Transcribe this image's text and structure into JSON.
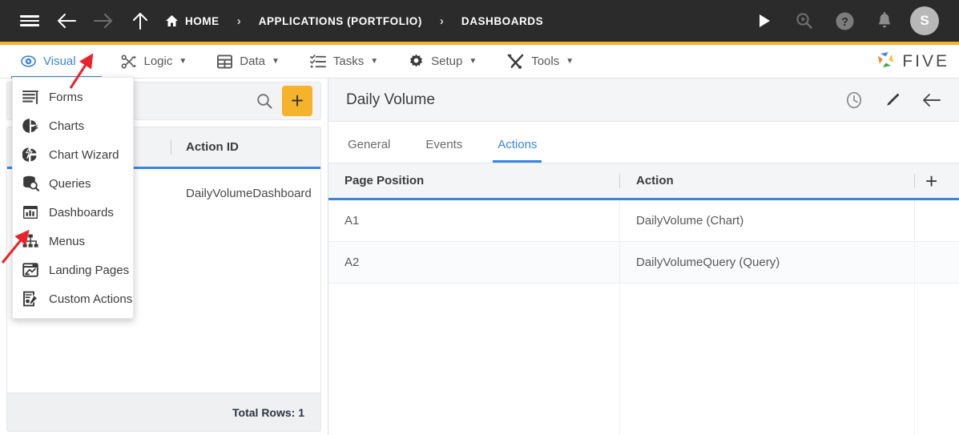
{
  "topbar": {
    "menu_icon": "hamburger-icon",
    "back_icon": "arrow-left-icon",
    "forward_icon": "arrow-right-icon",
    "up_icon": "arrow-up-icon",
    "breadcrumbs": [
      {
        "label": "HOME",
        "icon": "home-icon"
      },
      {
        "label": "APPLICATIONS (PORTFOLIO)",
        "icon": ""
      },
      {
        "label": "DASHBOARDS",
        "icon": ""
      }
    ],
    "separator": "›",
    "right_icons": [
      "run-icon",
      "debug-search-icon",
      "help-icon",
      "notifications-bell-icon"
    ],
    "avatar_initial": "S",
    "accent_color": "#f5b32c"
  },
  "menubar": {
    "items": [
      {
        "label": "Visual",
        "icon": "eye-icon",
        "caret": "▼",
        "active": true
      },
      {
        "label": "Logic",
        "icon": "logic-nodes-icon",
        "caret": "▼",
        "active": false
      },
      {
        "label": "Data",
        "icon": "table-grid-icon",
        "caret": "▼",
        "active": false
      },
      {
        "label": "Tasks",
        "icon": "checklist-icon",
        "caret": "▼",
        "active": false
      },
      {
        "label": "Setup",
        "icon": "gear-icon",
        "caret": "▼",
        "active": false
      },
      {
        "label": "Tools",
        "icon": "tools-icon",
        "caret": "▼",
        "active": false
      }
    ],
    "brand": "FIVE",
    "active_color": "#3b84e0"
  },
  "visual_dropdown": {
    "open": true,
    "items": [
      {
        "label": "Forms",
        "icon": "forms-lines-icon"
      },
      {
        "label": "Charts",
        "icon": "pie-chart-icon"
      },
      {
        "label": "Chart Wizard",
        "icon": "chart-wizard-icon"
      },
      {
        "label": "Queries",
        "icon": "database-search-icon"
      },
      {
        "label": "Dashboards",
        "icon": "dashboard-bars-icon"
      },
      {
        "label": "Menus",
        "icon": "menus-tree-icon"
      },
      {
        "label": "Landing Pages",
        "icon": "landing-page-icon"
      },
      {
        "label": "Custom Actions",
        "icon": "custom-actions-icon"
      }
    ]
  },
  "left_panel": {
    "search": {
      "value": "",
      "placeholder": "",
      "icon": "search-icon"
    },
    "add_button": {
      "label": "+",
      "icon": "plus-icon",
      "color": "#f5b32c"
    },
    "grid": {
      "columns": [
        "Action ID"
      ],
      "rows": [
        {
          "action_id": "DailyVolumeDashboard"
        }
      ],
      "footer": "Total Rows: 1"
    }
  },
  "right_panel": {
    "title": "Daily Volume",
    "header_icons": [
      "history-clock-icon",
      "edit-pencil-icon",
      "back-arrow-icon"
    ],
    "tabs": [
      {
        "label": "General",
        "active": false
      },
      {
        "label": "Events",
        "active": false
      },
      {
        "label": "Actions",
        "active": true
      }
    ],
    "grid": {
      "columns": [
        "Page Position",
        "Action"
      ],
      "add_column_icon": "plus-icon",
      "rows": [
        {
          "page_position": "A1",
          "action": "DailyVolume (Chart)"
        },
        {
          "page_position": "A2",
          "action": "DailyVolumeQuery (Query)"
        }
      ]
    }
  },
  "annotations": {
    "arrow_color": "#e8232a",
    "arrows": [
      {
        "name": "arrow-to-visual-caret",
        "points_to": "Visual dropdown caret"
      },
      {
        "name": "arrow-to-menus-item",
        "points_to": "Menus menu item"
      }
    ]
  }
}
